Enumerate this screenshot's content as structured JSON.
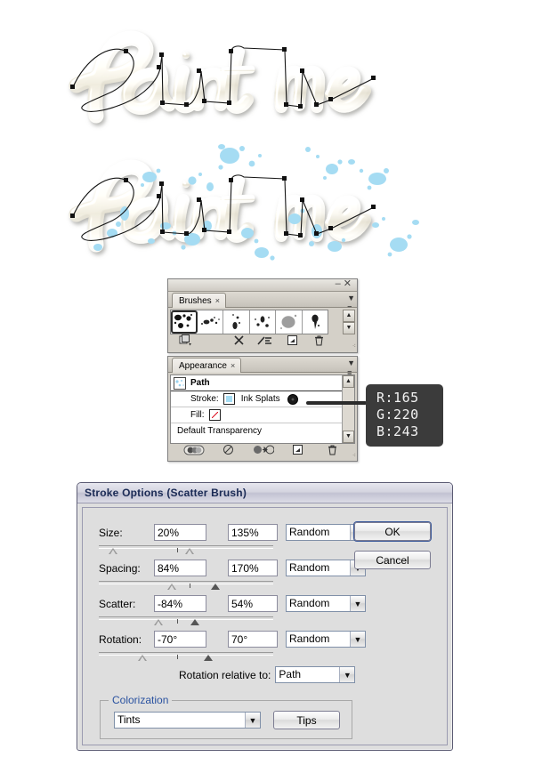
{
  "artwork": {
    "word": "Paint me",
    "top_caption": "cursive 3d lettering with vector path and anchor points",
    "bottom_caption": "same lettering with blue ink splat scatter brush applied",
    "splat_color": "#a5dcf3"
  },
  "brushes_panel": {
    "tab_label": "Brushes",
    "tab_close": "×",
    "minimize": "–",
    "close": "✕",
    "menu_icon": "panel-menu-icon",
    "scroll_up": "▲",
    "scroll_down": "▼",
    "brushes": [
      {
        "name": "ink-splats-brush",
        "selected": true
      },
      {
        "name": "splatter-brush-2",
        "selected": false
      },
      {
        "name": "splatter-brush-3",
        "selected": false
      },
      {
        "name": "splatter-brush-4",
        "selected": false
      },
      {
        "name": "blob-brush-5",
        "selected": false
      },
      {
        "name": "drip-brush-6",
        "selected": false
      }
    ],
    "tools": [
      {
        "name": "brush-libraries-menu-icon"
      },
      {
        "name": "remove-brush-stroke-icon"
      },
      {
        "name": "options-of-selected-object-icon"
      },
      {
        "name": "new-brush-icon"
      },
      {
        "name": "delete-brush-icon"
      }
    ]
  },
  "appearance_panel": {
    "tab_label": "Appearance",
    "tab_close": "×",
    "rows": {
      "path": "Path",
      "stroke_label": "Stroke:",
      "stroke_value": "Ink Splats",
      "fill_label": "Fill:",
      "fill_value": "None",
      "transparency": "Default Transparency"
    },
    "tools": [
      {
        "name": "add-new-stroke-icon"
      },
      {
        "name": "clear-appearance-icon"
      },
      {
        "name": "reduce-to-basic-appearance-icon"
      },
      {
        "name": "duplicate-selected-item-icon"
      },
      {
        "name": "delete-selected-item-icon"
      }
    ]
  },
  "color_tooltip": {
    "r": "R:165",
    "g": "G:220",
    "b": "B:243",
    "hex": "#a5dcf3"
  },
  "dialog": {
    "title": "Stroke Options (Scatter Brush)",
    "buttons": {
      "ok": "OK",
      "cancel": "Cancel",
      "tips": "Tips"
    },
    "fields": [
      {
        "name": "size",
        "label": "Size:",
        "min_value": "20%",
        "max_value": "135%",
        "mode": "Random",
        "thumb_left_pct": 8,
        "thumb_right_pct": 52,
        "tick_pct": 45
      },
      {
        "name": "spacing",
        "label": "Spacing:",
        "min_value": "84%",
        "max_value": "170%",
        "mode": "Random",
        "thumb_left_pct": 42,
        "thumb_right_pct": 67,
        "tick_pct": 52
      },
      {
        "name": "scatter",
        "label": "Scatter:",
        "min_value": "-84%",
        "max_value": "54%",
        "mode": "Random",
        "thumb_left_pct": 34,
        "thumb_right_pct": 55,
        "tick_pct": 45
      },
      {
        "name": "rotation",
        "label": "Rotation:",
        "min_value": "-70°",
        "max_value": "70°",
        "mode": "Random",
        "thumb_left_pct": 25,
        "thumb_right_pct": 63,
        "tick_pct": 45
      }
    ],
    "rotation_relative": {
      "label": "Rotation relative to:",
      "value": "Path"
    },
    "colorization": {
      "title": "Colorization",
      "method": "Tints"
    },
    "dropdown_arrow": "⌄"
  }
}
